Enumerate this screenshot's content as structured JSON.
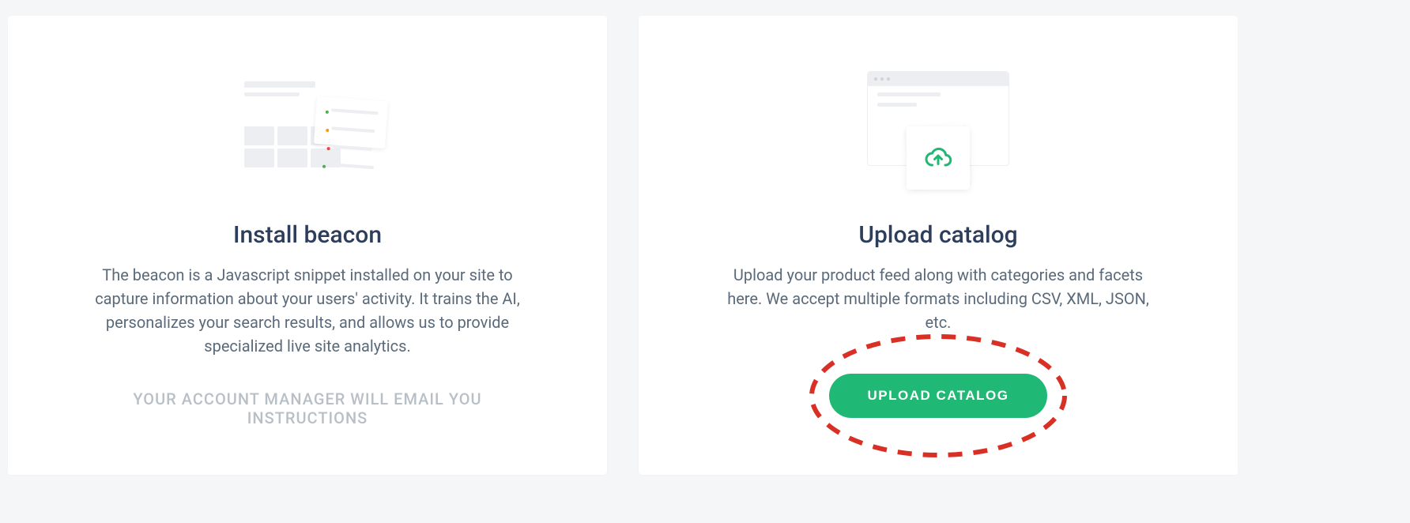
{
  "cards": {
    "install_beacon": {
      "title": "Install beacon",
      "description": "The beacon is a Javascript snippet installed on your site to capture information about your users' activity. It trains the AI, personalizes your search results, and allows us to provide specialized live site analytics.",
      "footer_text": "YOUR ACCOUNT MANAGER WILL EMAIL YOU INSTRUCTIONS"
    },
    "upload_catalog": {
      "title": "Upload catalog",
      "description": "Upload your product feed along with categories and facets here. We accept multiple formats including CSV, XML, JSON, etc.",
      "button_label": "UPLOAD CATALOG"
    }
  },
  "icons": {
    "beacon_illustration": "code-snippet-page-icon",
    "upload_illustration": "cloud-upload-document-icon"
  },
  "colors": {
    "accent_green": "#1fb874",
    "highlight_red": "#d93025",
    "title_color": "#2d3e5a",
    "body_text": "#5a6a7a",
    "muted_text": "#b8bfc7"
  }
}
